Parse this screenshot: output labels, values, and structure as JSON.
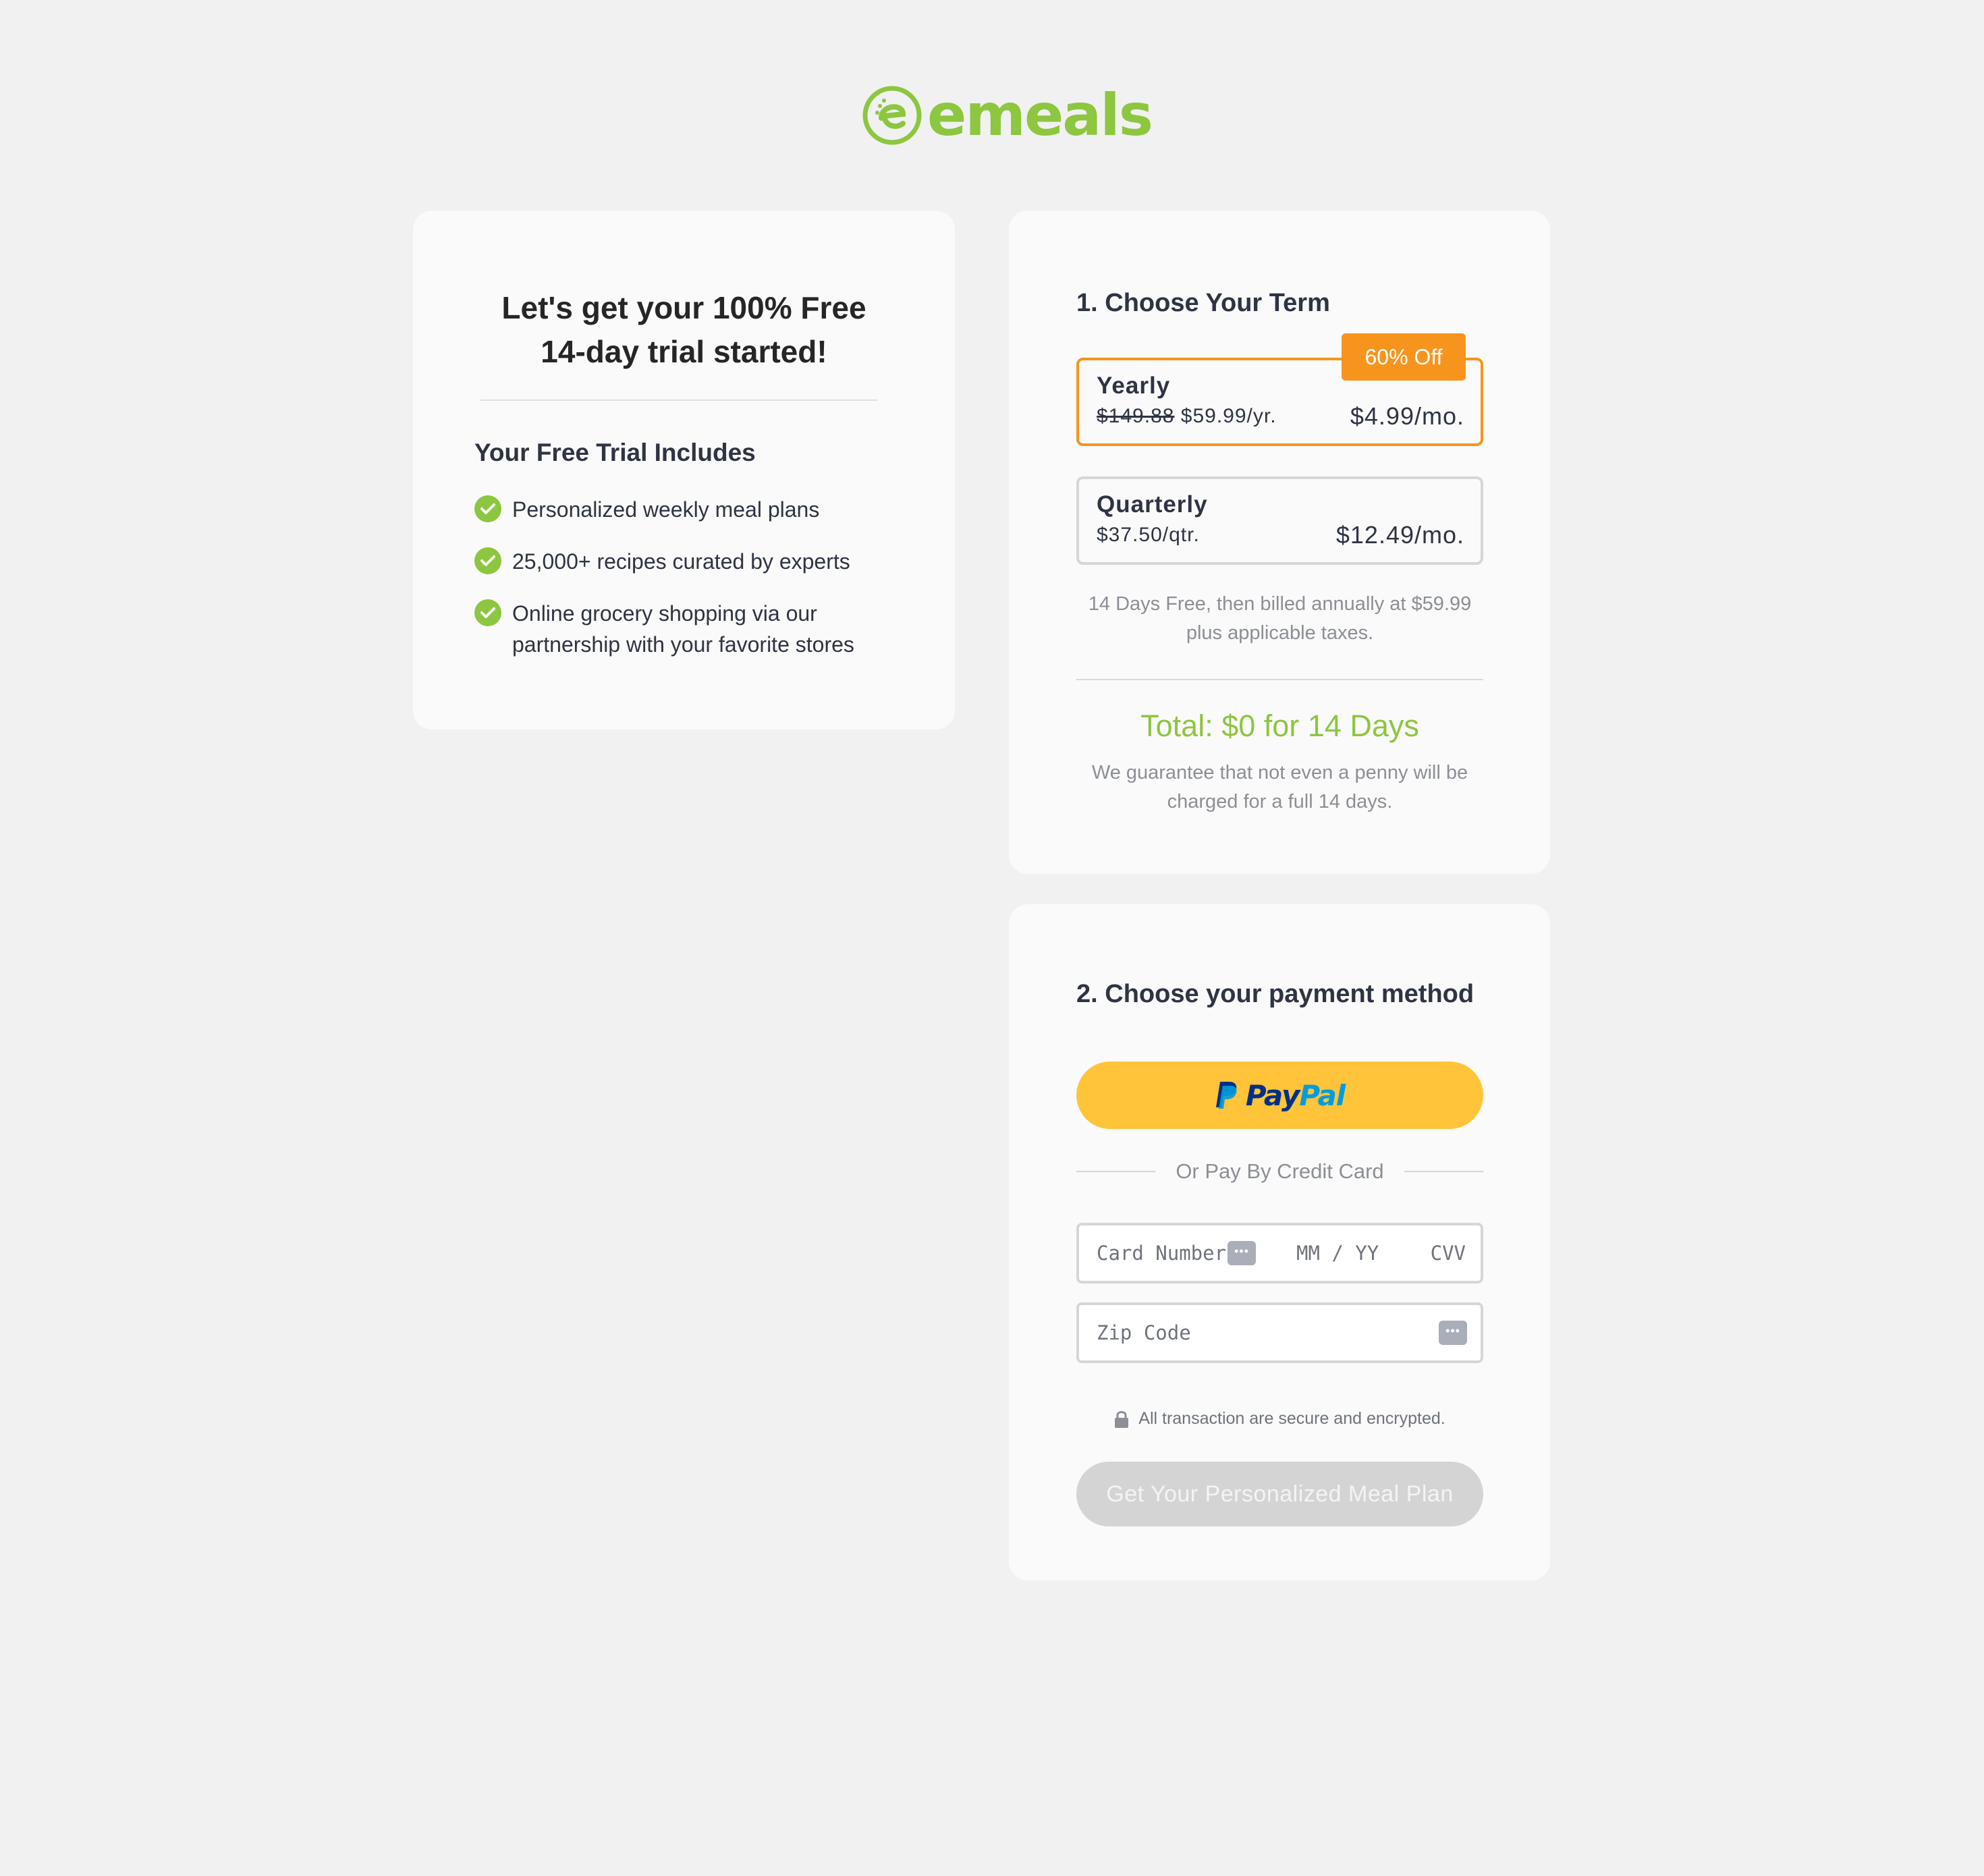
{
  "brand": {
    "name": "emeals",
    "color": "#8dc63f",
    "icon": "emeals-logo-icon"
  },
  "trial_card": {
    "title_line1": "Let's get your 100% Free",
    "title_line2": "14-day trial started!",
    "includes_title": "Your Free Trial Includes",
    "features": [
      {
        "icon": "check-circle-icon",
        "text": "Personalized weekly meal plans"
      },
      {
        "icon": "check-circle-icon",
        "text": "25,000+ recipes curated by experts"
      },
      {
        "icon": "check-circle-icon",
        "text": "Online grocery shopping via our partnership with your favorite stores"
      }
    ]
  },
  "term": {
    "step_title": "1. Choose Your Term",
    "plans": [
      {
        "name": "Yearly",
        "original_price": "$149.88",
        "price": "$59.99/yr.",
        "monthly": "$4.99/mo.",
        "badge": "60% Off",
        "selected": true
      },
      {
        "name": "Quarterly",
        "price": "$37.50/qtr.",
        "monthly": "$12.49/mo.",
        "selected": false
      }
    ],
    "billing_note": "14 Days Free, then billed annually at $59.99 plus applicable taxes.",
    "total": "Total: $0 for 14 Days",
    "guarantee": "We guarantee that not even a penny will be charged for a full 14 days.",
    "accent_color": "#f7941d"
  },
  "payment": {
    "step_title": "2. Choose your payment method",
    "paypal": {
      "pay": "Pay",
      "pal": "Pal",
      "icon": "paypal-icon",
      "color": "#ffc439"
    },
    "divider_text": "Or Pay By Credit Card",
    "card_number_placeholder": "Card Number",
    "expiry_placeholder": "MM / YY",
    "cvv_placeholder": "CVV",
    "zip_placeholder": "Zip Code",
    "autofill_icon": "autofill-icon",
    "secure_text": "All transaction are secure and encrypted.",
    "submit_label": "Get Your Personalized Meal Plan"
  }
}
